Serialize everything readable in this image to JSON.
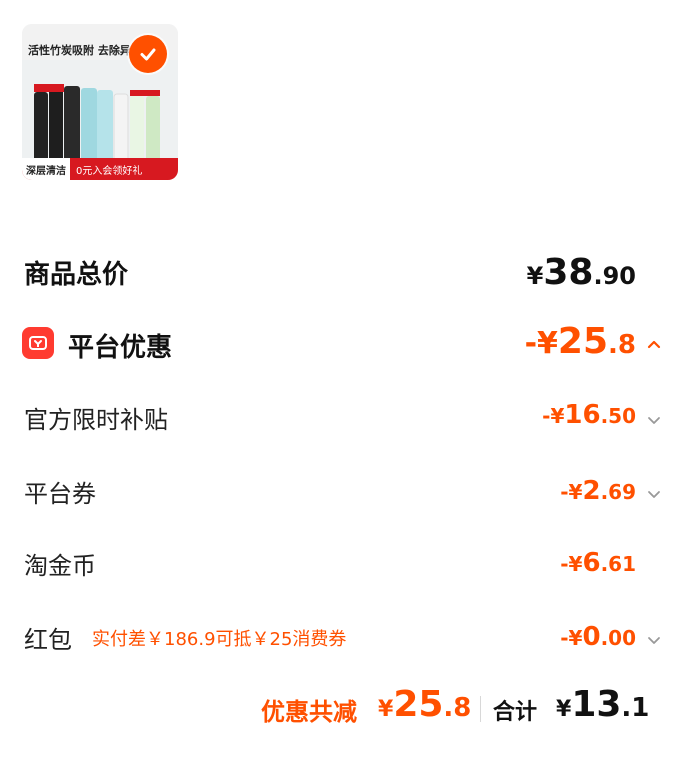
{
  "product": {
    "banner_text": "活性竹炭吸附 去除异味",
    "bottom_left": "深层清洁",
    "bottom_right": "0元入会领好礼",
    "selected": true
  },
  "summary": {
    "total": {
      "label": "商品总价",
      "currency": "¥",
      "int": "38",
      "dec": ".90"
    },
    "platform": {
      "label": "平台优惠",
      "sign_currency": "-¥",
      "int": "25",
      "dec": ".8",
      "expanded": true
    },
    "items": [
      {
        "label": "官方限时补贴",
        "sign_currency": "-¥",
        "int": "16",
        "dec": ".50",
        "has_chevron": true
      },
      {
        "label": "平台券",
        "sign_currency": "-¥",
        "int": "2",
        "dec": ".69",
        "has_chevron": true
      },
      {
        "label": "淘金币",
        "sign_currency": "-¥",
        "int": "6",
        "dec": ".61",
        "has_chevron": false
      },
      {
        "label": "红包",
        "note": "实付差￥186.9可抵￥25消费券",
        "sign_currency": "-¥",
        "int": "0",
        "dec": ".00",
        "has_chevron": true
      }
    ]
  },
  "footer": {
    "discount_label": "优惠共减",
    "discount_currency": "¥",
    "discount_int": "25",
    "discount_dec": ".8",
    "sum_label": "合计",
    "sum_currency": "¥",
    "sum_int": "13",
    "sum_dec": ".1"
  },
  "colors": {
    "accent": "#ff5000",
    "badge": "#ff3b30",
    "brand_red": "#d71920"
  }
}
